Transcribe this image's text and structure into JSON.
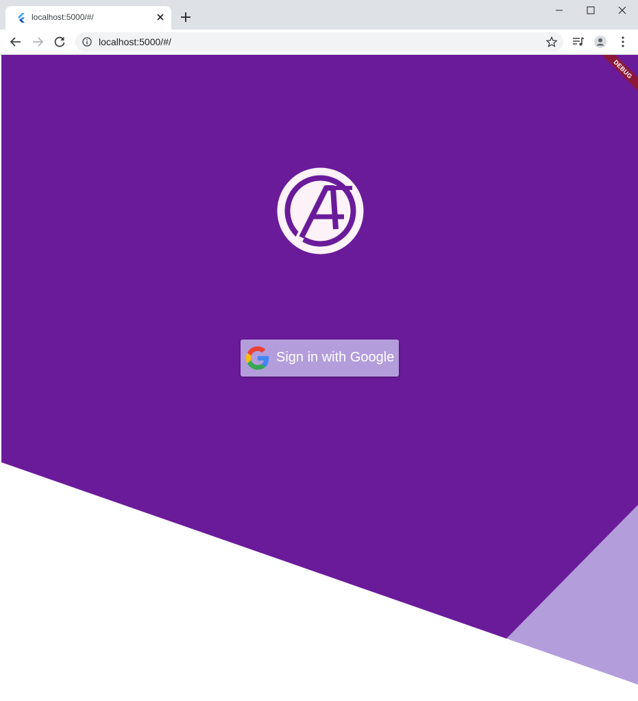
{
  "browser": {
    "tab": {
      "title": "localhost:5000/#/"
    },
    "address_bar": {
      "url": "localhost:5000/#/"
    }
  },
  "app": {
    "debug_banner": "DEBUG",
    "sign_in_button": {
      "label": "Sign in with Google"
    },
    "colors": {
      "primary": "#6a1b9a",
      "accent": "#b39ddb",
      "logo_fill": "#fcf2f7"
    }
  }
}
